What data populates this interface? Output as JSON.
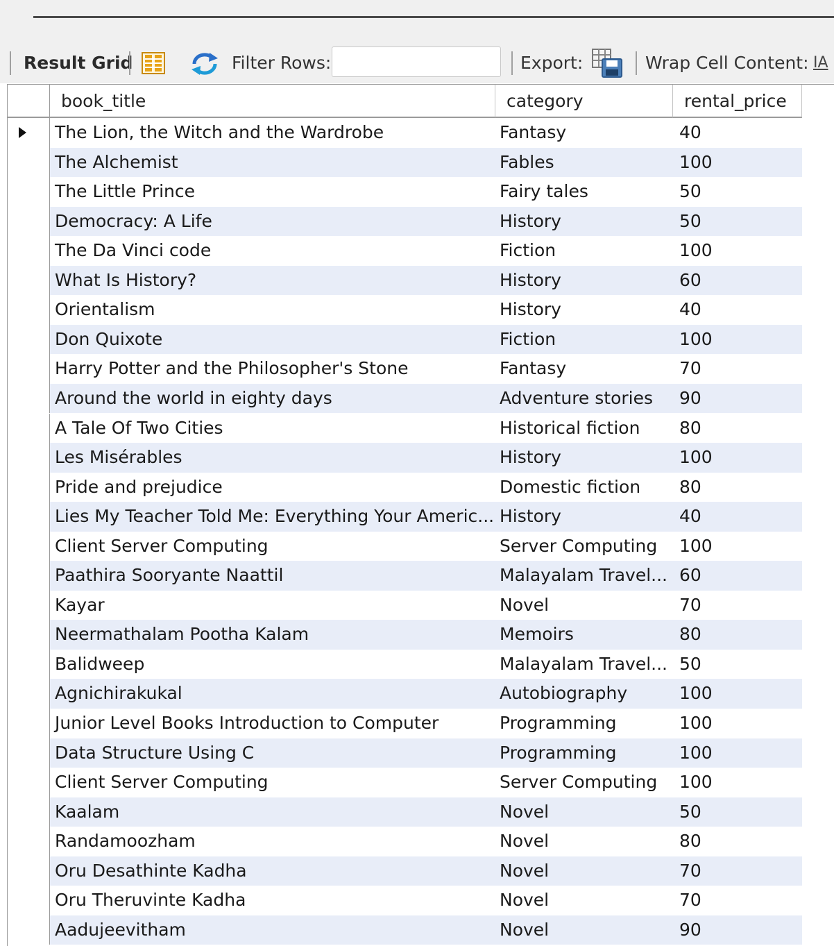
{
  "toolbar": {
    "result_grid_label": "Result Grid",
    "filter_rows_label": "Filter Rows:",
    "filter_value": "",
    "export_label": "Export:",
    "wrap_cell_label": "Wrap Cell Content:",
    "wrap_icon_glyph": "IA"
  },
  "grid": {
    "columns": [
      "book_title",
      "category",
      "rental_price"
    ],
    "rows": [
      {
        "book_title": "The Lion, the Witch and the Wardrobe",
        "category": "Fantasy",
        "rental_price": "40"
      },
      {
        "book_title": "The Alchemist",
        "category": "Fables",
        "rental_price": "100"
      },
      {
        "book_title": "The Little Prince",
        "category": "Fairy tales",
        "rental_price": "50"
      },
      {
        "book_title": "Democracy: A Life",
        "category": "History",
        "rental_price": "50"
      },
      {
        "book_title": "The Da Vinci code",
        "category": "Fiction",
        "rental_price": "100"
      },
      {
        "book_title": "What Is History?",
        "category": "History",
        "rental_price": "60"
      },
      {
        "book_title": "Orientalism",
        "category": "History",
        "rental_price": "40"
      },
      {
        "book_title": "Don Quixote",
        "category": "Fiction",
        "rental_price": "100"
      },
      {
        "book_title": "Harry Potter and the Philosopher's Stone",
        "category": "Fantasy",
        "rental_price": "70"
      },
      {
        "book_title": "Around the world in eighty days",
        "category": "Adventure stories",
        "rental_price": "90"
      },
      {
        "book_title": "A Tale Of Two Cities",
        "category": "Historical fiction",
        "rental_price": "80"
      },
      {
        "book_title": "Les Misérables",
        "category": "History",
        "rental_price": "100"
      },
      {
        "book_title": "Pride and prejudice",
        "category": "Domestic fiction",
        "rental_price": "80"
      },
      {
        "book_title": "Lies My Teacher Told Me: Everything Your Americ...",
        "category": "History",
        "rental_price": "40"
      },
      {
        "book_title": "Client Server Computing",
        "category": "Server Computing",
        "rental_price": "100"
      },
      {
        "book_title": "Paathira Sooryante Naattil",
        "category": "Malayalam Travel...",
        "rental_price": "60"
      },
      {
        "book_title": "Kayar",
        "category": "Novel",
        "rental_price": "70"
      },
      {
        "book_title": "Neermathalam Pootha Kalam",
        "category": "Memoirs",
        "rental_price": "80"
      },
      {
        "book_title": "Balidweep",
        "category": "Malayalam Travel...",
        "rental_price": "50"
      },
      {
        "book_title": "Agnichirakukal",
        "category": "Autobiography",
        "rental_price": "100"
      },
      {
        "book_title": "Junior Level Books Introduction to Computer",
        "category": "Programming",
        "rental_price": "100"
      },
      {
        "book_title": "Data Structure Using C",
        "category": "Programming",
        "rental_price": "100"
      },
      {
        "book_title": "Client Server Computing",
        "category": "Server Computing",
        "rental_price": "100"
      },
      {
        "book_title": "Kaalam",
        "category": "Novel",
        "rental_price": "50"
      },
      {
        "book_title": "Randamoozham",
        "category": "Novel",
        "rental_price": "80"
      },
      {
        "book_title": "Oru Desathinte Kadha",
        "category": "Novel",
        "rental_price": "70"
      },
      {
        "book_title": "Oru Theruvinte Kadha",
        "category": "Novel",
        "rental_price": "70"
      },
      {
        "book_title": "Aadujeevitham",
        "category": "Novel",
        "rental_price": "90"
      }
    ]
  },
  "icons": {
    "form_view": "form-editor-icon",
    "refresh": "refresh-icon",
    "export": "export-icon",
    "wrap": "wrap-cell-icon",
    "row_marker": "current-row-arrow-icon"
  },
  "colors": {
    "toolbar_bg": "#f0f0f0",
    "alt_row_bg": "#e8edf8",
    "icon_orange": "#e8a317",
    "icon_blue": "#2a6fc9"
  }
}
